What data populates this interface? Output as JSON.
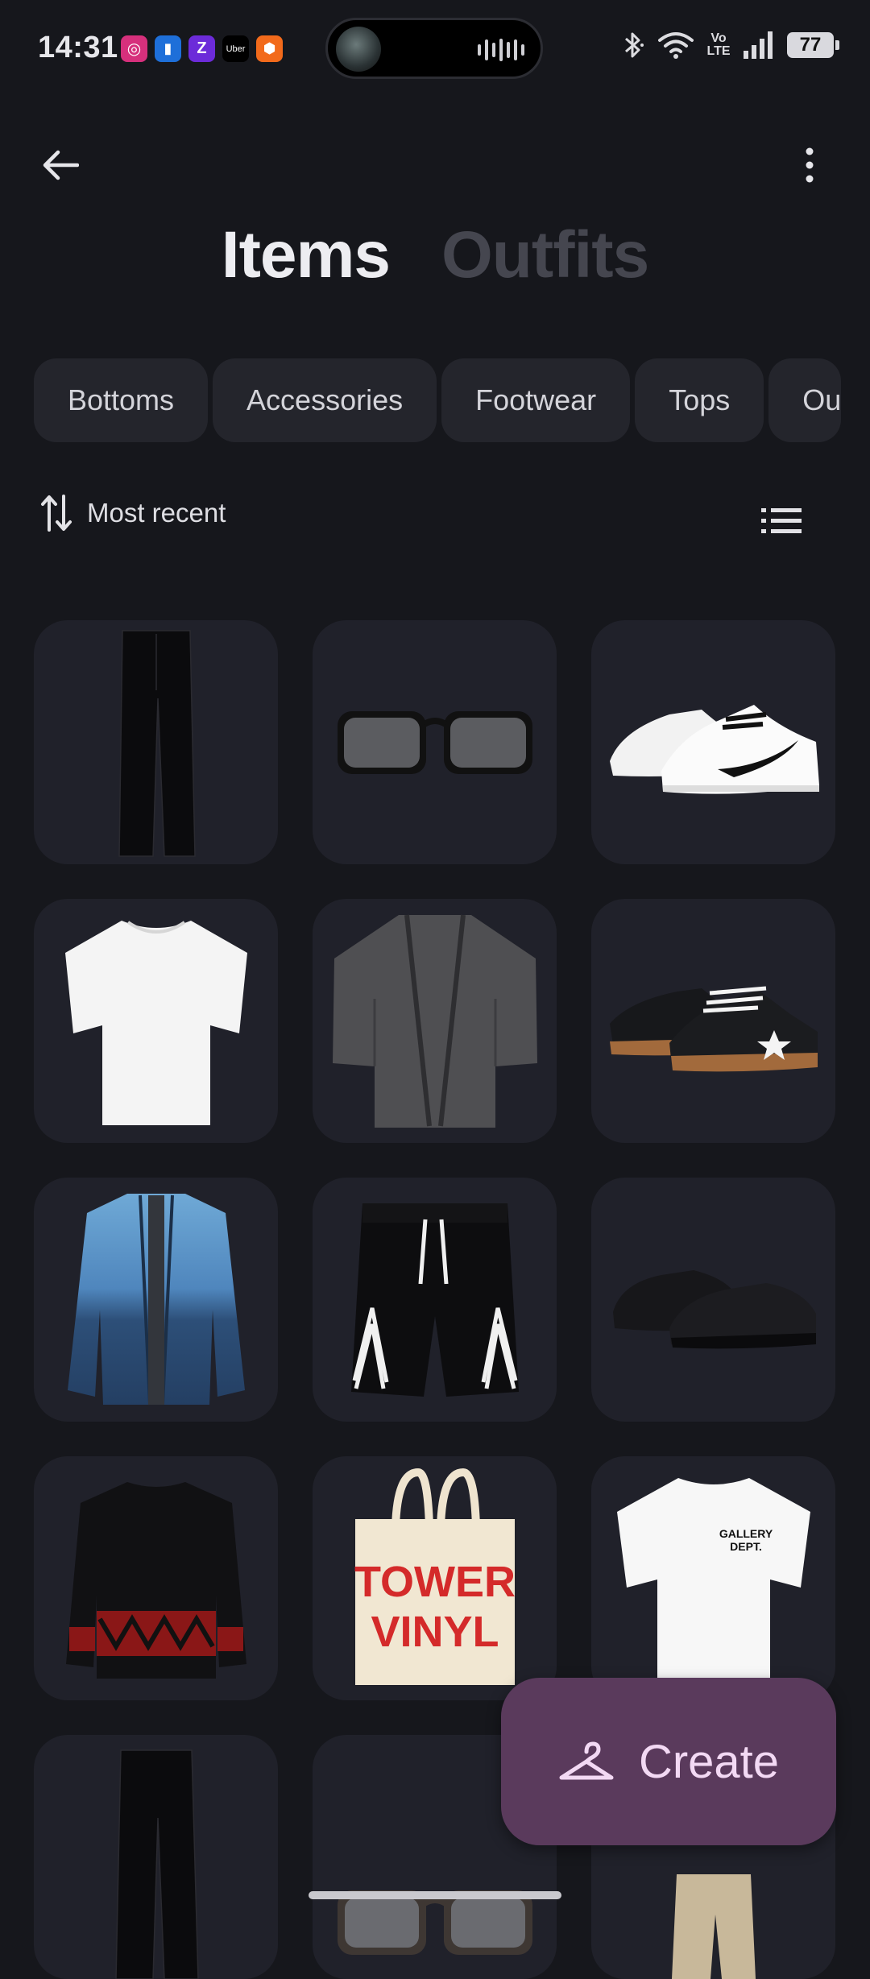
{
  "status_bar": {
    "time": "14:31",
    "battery": "77",
    "network_label": "Vo LTE",
    "notification_icons": [
      {
        "name": "instagram-icon",
        "color": "#d6307c",
        "glyph": "◎"
      },
      {
        "name": "phone-link-icon",
        "color": "#1e6fd9",
        "glyph": "▮"
      },
      {
        "name": "zepto-icon",
        "color": "#6c2bd9",
        "glyph": "Z"
      },
      {
        "name": "uber-icon",
        "color": "#000000",
        "glyph": "Uber"
      },
      {
        "name": "swiggy-icon",
        "color": "#f26a1b",
        "glyph": "⬢"
      }
    ]
  },
  "header": {
    "tabs": [
      {
        "label": "Items",
        "active": true
      },
      {
        "label": "Outfits",
        "active": false
      }
    ]
  },
  "filters": {
    "chips": [
      "Bottoms",
      "Accessories",
      "Footwear",
      "Tops",
      "Ou"
    ]
  },
  "sort": {
    "label": "Most recent"
  },
  "items": [
    {
      "name": "black-trousers"
    },
    {
      "name": "black-sunglasses"
    },
    {
      "name": "white-nike-sneakers"
    },
    {
      "name": "white-tshirt"
    },
    {
      "name": "grey-kimono-cardigan"
    },
    {
      "name": "black-converse-sneakers"
    },
    {
      "name": "blue-dip-dye-denim-jacket"
    },
    {
      "name": "black-basketball-shorts"
    },
    {
      "name": "black-slip-on-shoes"
    },
    {
      "name": "black-patterned-sweater"
    },
    {
      "name": "tower-vinyl-tote-bag",
      "text_line1": "TOWER",
      "text_line2": "VINYL"
    },
    {
      "name": "gallery-dept-tshirt",
      "text_line1": "GALLERY",
      "text_line2": "DEPT."
    },
    {
      "name": "black-trousers-2"
    },
    {
      "name": "wood-sunglasses"
    },
    {
      "name": "beige-trousers"
    }
  ],
  "fab": {
    "label": "Create"
  },
  "colors": {
    "background": "#16171c",
    "card": "#20212a",
    "chip": "#24252c",
    "fab": "#5a3a5c",
    "fab_text": "#f3d9f4"
  }
}
